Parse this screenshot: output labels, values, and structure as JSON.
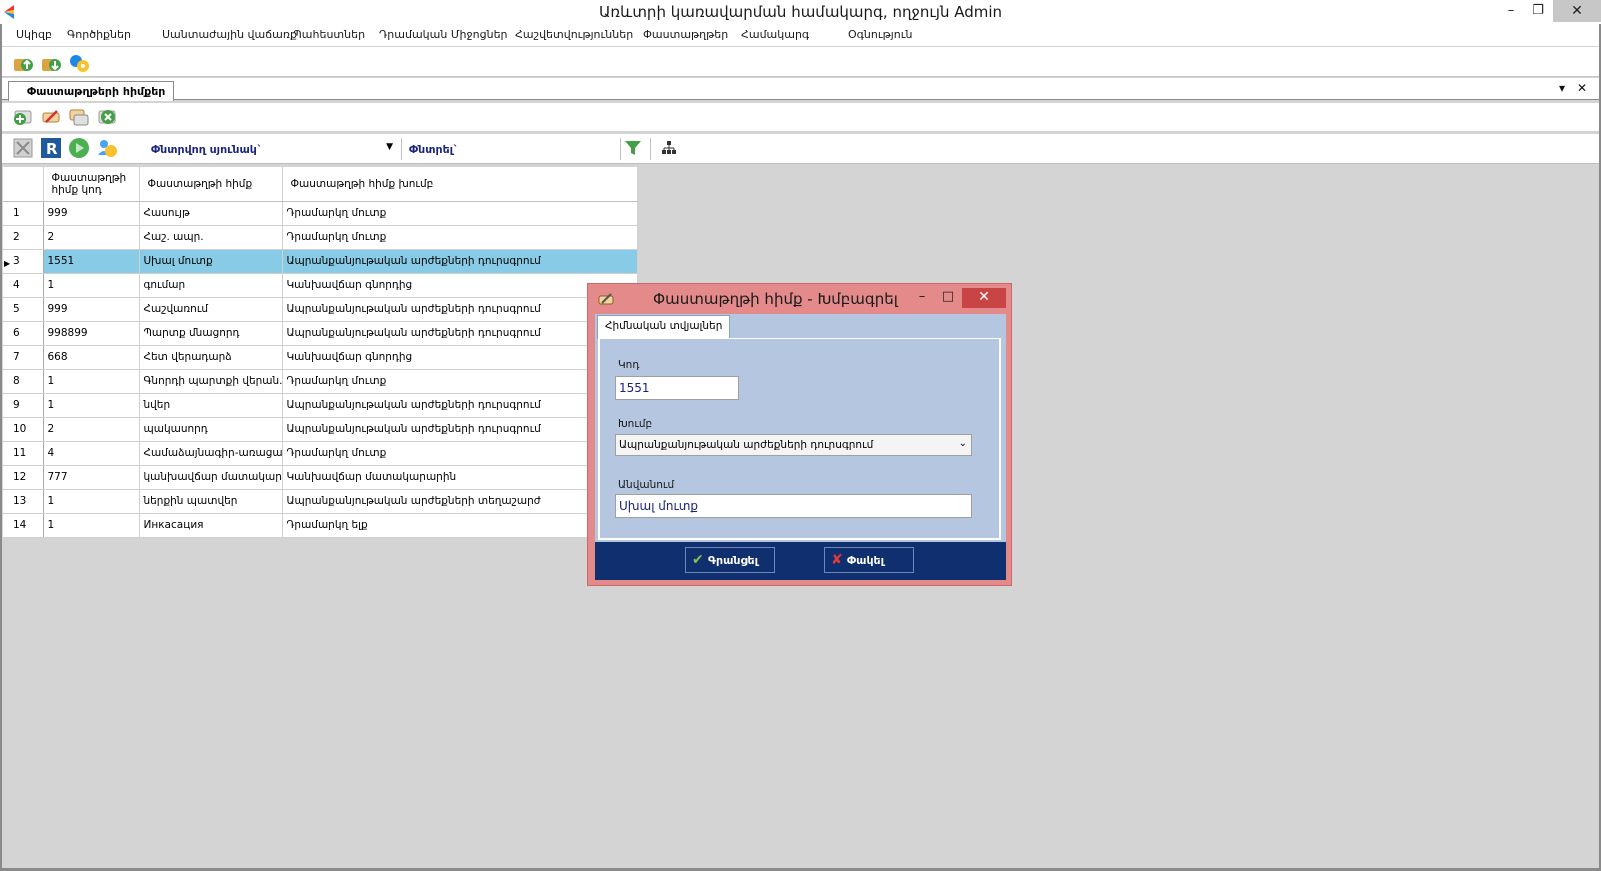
{
  "window": {
    "title": "Առևտրի կառավարման համակարգ, ողջույն Admin",
    "min_glyph": "–",
    "max_glyph": "❐",
    "close_glyph": "✕"
  },
  "menu": [
    "Սկիզբ",
    "Գործիքներ",
    "Սանտաժային վաճառք",
    "Պահեստներ",
    "Դրամական Միջոցներ",
    "Հաշվետվություններ",
    "Փաստաթղթեր",
    "Համակարգ",
    "Օգնություն"
  ],
  "doc_tab": {
    "label": "Փաստաթղթերի հիմքեր",
    "dropdown_glyph": "▾",
    "close_glyph": "✕"
  },
  "filter": {
    "search_column_label": "Փնտրվող սյունակ`",
    "search_label": "Փնտրել`",
    "search_value": ""
  },
  "grid": {
    "columns": [
      "Փաստաթղթի հիմք կոդ",
      "Փաստաթղթի հիմք",
      "Փաստաթղթի հիմք խումբ"
    ],
    "selected_row": 3,
    "rows": [
      {
        "n": "1",
        "code": "999",
        "name": "Հասույթ",
        "group": "Դրամարկղ մուտք"
      },
      {
        "n": "2",
        "code": "2",
        "name": "Հաշ. ապր.",
        "group": "Դրամարկղ մուտք"
      },
      {
        "n": "3",
        "code": "1551",
        "name": "Սխալ մուտք",
        "group": "Ապրանքանյութական արժեքների դուրսգրում"
      },
      {
        "n": "4",
        "code": "1",
        "name": "գումար",
        "group": "Կանխավճար գնորդից"
      },
      {
        "n": "5",
        "code": "999",
        "name": "Հաշվառում",
        "group": "Ապրանքանյութական արժեքների դուրսգրում"
      },
      {
        "n": "6",
        "code": "998899",
        "name": "Պարտք մնացորդ",
        "group": "Ապրանքանյութական արժեքների դուրսգրում"
      },
      {
        "n": "7",
        "code": "668",
        "name": "Հետ վերադարձ",
        "group": "Կանխավճար գնորդից"
      },
      {
        "n": "8",
        "code": "1",
        "name": "Գնորդի պարտքի վերան...",
        "group": "Դրամարկղ մուտք"
      },
      {
        "n": "9",
        "code": "1",
        "name": "նվեր",
        "group": "Ապրանքանյութական արժեքների դուրսգրում"
      },
      {
        "n": "10",
        "code": "2",
        "name": "պակասորդ",
        "group": "Ապրանքանյութական արժեքների դուրսգրում"
      },
      {
        "n": "11",
        "code": "4",
        "name": "Համաձայնագիր-առացա...",
        "group": "Դրամարկղ մուտք"
      },
      {
        "n": "12",
        "code": "777",
        "name": "կանխավճար մատակար...",
        "group": "Կանխավճար մատակարարին"
      },
      {
        "n": "13",
        "code": "1",
        "name": "ներքին պատվեր",
        "group": "Ապրանքանյութական արժեքների տեղաշարժ"
      },
      {
        "n": "14",
        "code": "1",
        "name": "Инкасация",
        "group": "Դրամարկղ ելք"
      }
    ]
  },
  "dialog": {
    "title": "Փաստաթղթի հիմք - Խմբագրել",
    "tab": "Հիմնական տվյալներ",
    "code_label": "Կոդ",
    "code_value": "1551",
    "group_label": "Խումբ",
    "group_value": "Ապրանքանյութական արժեքների դուրսգրում",
    "name_label": "Անվանում",
    "name_value": "Սխալ մուտք",
    "save_label": "Գրանցել",
    "cancel_label": "Փակել",
    "min_glyph": "–",
    "max_glyph": "□",
    "close_glyph": "✕"
  }
}
